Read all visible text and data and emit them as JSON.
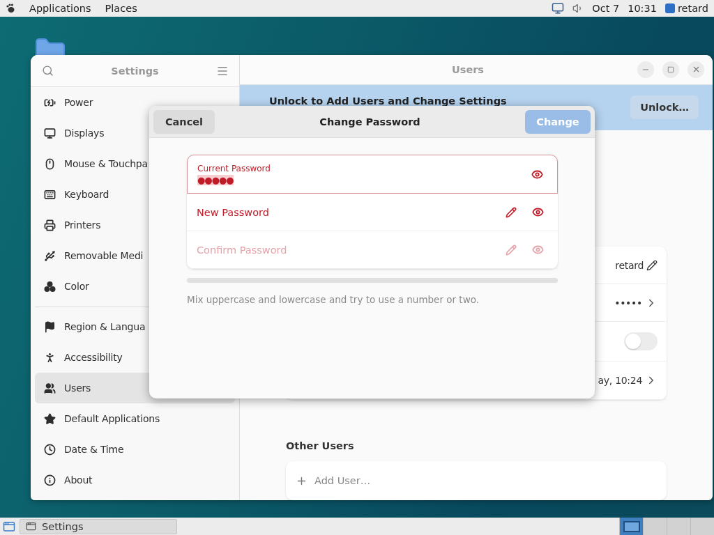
{
  "top_panel": {
    "menus": [
      "Applications",
      "Places"
    ],
    "date": "Oct 7",
    "time": "10:31",
    "user": "retard"
  },
  "window": {
    "sidebar_title": "Settings",
    "title": "Users"
  },
  "sidebar": {
    "groups": [
      [
        {
          "label": "Power",
          "kind": "power",
          "selected": false
        },
        {
          "label": "Displays",
          "kind": "display",
          "selected": false
        },
        {
          "label": "Mouse & Touchpa",
          "kind": "mouse",
          "selected": false
        },
        {
          "label": "Keyboard",
          "kind": "keyboard",
          "selected": false
        },
        {
          "label": "Printers",
          "kind": "printer",
          "selected": false
        },
        {
          "label": "Removable Medi",
          "kind": "usb",
          "selected": false
        },
        {
          "label": "Color",
          "kind": "color",
          "selected": false
        }
      ],
      [
        {
          "label": "Region & Langua",
          "kind": "flag",
          "selected": false
        },
        {
          "label": "Accessibility",
          "kind": "accessibility",
          "selected": false
        },
        {
          "label": "Users",
          "kind": "users",
          "selected": true
        },
        {
          "label": "Default Applications",
          "kind": "star",
          "selected": false
        },
        {
          "label": "Date & Time",
          "kind": "clock",
          "selected": false
        },
        {
          "label": "About",
          "kind": "info",
          "selected": false
        }
      ]
    ]
  },
  "banner": {
    "text": "Unlock to Add Users and Change Settings",
    "button": "Unlock…"
  },
  "account_card": {
    "rows": [
      {
        "kind": "edit",
        "value": "retard"
      },
      {
        "kind": "link",
        "value": "•••••"
      },
      {
        "kind": "switch",
        "on": false
      },
      {
        "kind": "link",
        "value": "ay, 10:24"
      }
    ]
  },
  "other_users": {
    "title": "Other Users",
    "add": "Add User…"
  },
  "dialog": {
    "title": "Change Password",
    "cancel": "Cancel",
    "confirm": {
      "label": "Change",
      "disabled": true
    },
    "fields": [
      {
        "label": "Current Password",
        "value": "●●●●●",
        "focused": true,
        "disabled": false
      },
      {
        "label": "New Password",
        "focused": false,
        "disabled": false
      },
      {
        "label": "Confirm Password",
        "focused": false,
        "disabled": true
      }
    ],
    "strength": {
      "level": 0
    },
    "hint": "Mix uppercase and lowercase and try to use a number or two."
  },
  "taskbar": {
    "tasks": [
      {
        "label": "Settings",
        "selected": false
      }
    ],
    "workspaces": [
      {
        "selected": true
      },
      {
        "selected": false
      },
      {
        "selected": false
      },
      {
        "selected": false
      }
    ]
  }
}
